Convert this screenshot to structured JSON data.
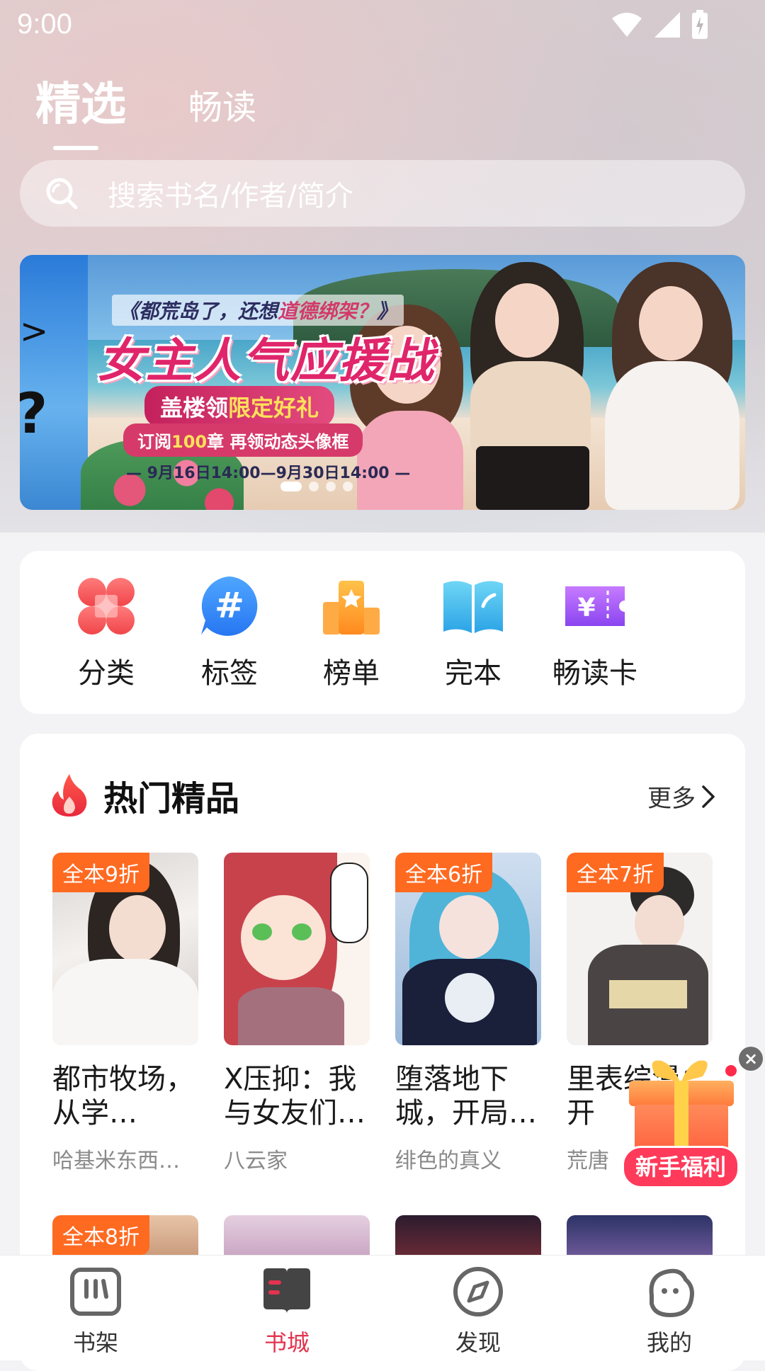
{
  "status_bar": {
    "time": "9:00"
  },
  "top_tabs": [
    {
      "label": "精选",
      "active": true
    },
    {
      "label": "畅读",
      "active": false
    }
  ],
  "search": {
    "placeholder": "搜索书名/作者/简介"
  },
  "banner": {
    "left_peek_text": "?",
    "subtitle_pre": "《都荒岛了，还想",
    "subtitle_highlight": "道德绑架？",
    "subtitle_post": "》",
    "title": "女主人气应援战",
    "gift_pre": "盖楼领",
    "gift_highlight": "限定好礼",
    "sub2_pre": "订阅",
    "sub2_highlight": "100",
    "sub2_post": "章 再领动态头像框",
    "date": "— 9月16日14:00—9月30日14:00 —",
    "dots_total": 4,
    "dots_active": 0
  },
  "categories": [
    {
      "label": "分类",
      "icon": "category-icon"
    },
    {
      "label": "标签",
      "icon": "hashtag-icon"
    },
    {
      "label": "榜单",
      "icon": "ranking-icon"
    },
    {
      "label": "完本",
      "icon": "open-book-icon"
    },
    {
      "label": "畅读卡",
      "icon": "ticket-icon"
    }
  ],
  "hot_section": {
    "title": "热门精品",
    "more_label": "更多",
    "books": [
      {
        "badge": "全本9折",
        "title": "都市牧场，从学…",
        "author": "哈基米东西…"
      },
      {
        "badge": "",
        "title": "X压抑：我与女友们…",
        "author": "八云家"
      },
      {
        "badge": "全本6折",
        "title": "堕落地下城，开局…",
        "author": "绯色的真义"
      },
      {
        "badge": "全本7折",
        "title": "里表综漫：开",
        "author": "荒唐"
      }
    ],
    "next_row_badge": "全本8折"
  },
  "gift_float": {
    "label": "新手福利",
    "close": "×"
  },
  "bottom_nav": [
    {
      "label": "书架",
      "icon": "bookshelf-icon",
      "active": false
    },
    {
      "label": "书城",
      "icon": "bookstore-icon",
      "active": true
    },
    {
      "label": "发现",
      "icon": "compass-icon",
      "active": false
    },
    {
      "label": "我的",
      "icon": "profile-icon",
      "active": false
    }
  ],
  "colors": {
    "accent": "#e3334f",
    "badge": "#ff6a21",
    "flame": "#f0463c"
  }
}
